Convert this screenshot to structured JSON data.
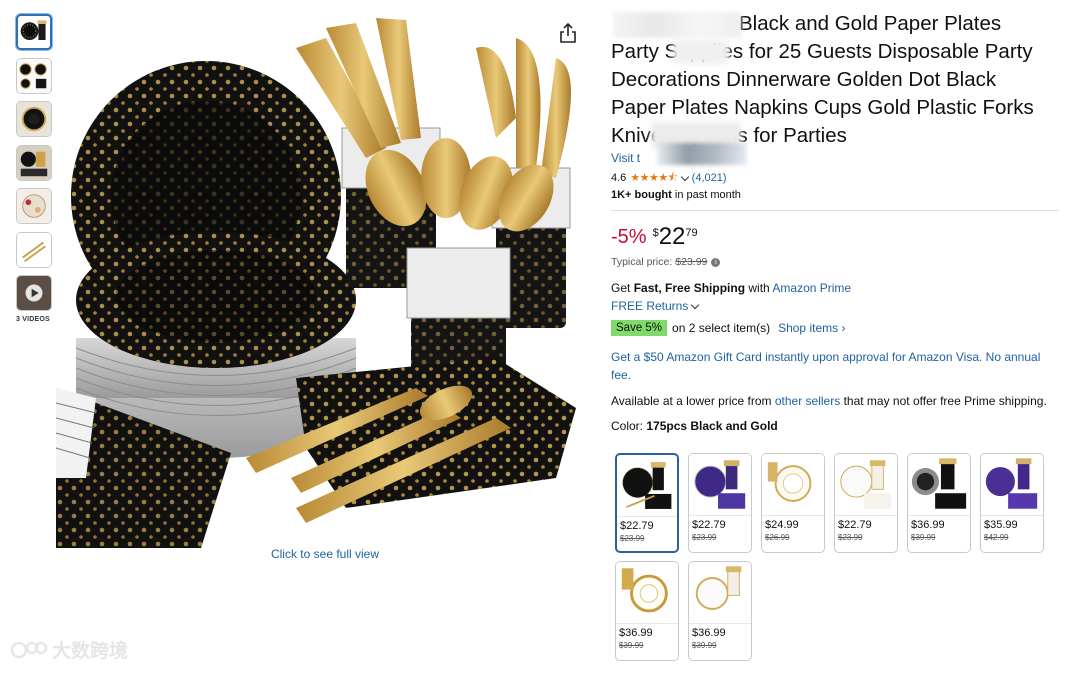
{
  "thumbnails": {
    "icons": [
      "product-thumb-1",
      "product-thumb-2",
      "product-thumb-3",
      "product-thumb-4",
      "product-thumb-5",
      "product-thumb-6",
      "video-thumb"
    ],
    "videos_label": "3 VIDEOS"
  },
  "main": {
    "full_view_label": "Click to see full view",
    "share_icon": "share-icon"
  },
  "product": {
    "title_line1": "Black and Gold Paper Plates",
    "title_line2": "Party Supplies for 25 Guests Disposable Party",
    "title_line3": "Decorations Dinnerware Golden Dot Black",
    "title_line4": "Paper Plates Napkins Cups Gold Plastic Forks",
    "title_line5": "Knives Spoons for Parties",
    "store_prefix": "Visit t",
    "rating": "4.6",
    "stars": "★★★★⯪",
    "rating_count": "(4,021)",
    "bought_bold": "1K+ bought",
    "bought_rest": " in past month"
  },
  "price": {
    "discount": "-5%",
    "currency": "$",
    "whole": "22",
    "fraction": "79",
    "typical_label": "Typical price:",
    "typical_value": "$23.99",
    "info_icon": "i"
  },
  "shipping": {
    "prefix": "Get ",
    "bold": "Fast, Free Shipping",
    "middle": " with ",
    "link": "Amazon Prime",
    "returns": "FREE Returns"
  },
  "promo": {
    "badge": "Save 5%",
    "text": "on 2 select item(s)",
    "link": "Shop items ›"
  },
  "gift_card": "Get a $50 Amazon Gift Card instantly upon approval for Amazon Visa. No annual fee.",
  "availability": {
    "prefix": "Available at a lower price from ",
    "link": "other sellers",
    "suffix": " that may not offer free Prime shipping."
  },
  "color": {
    "label": "Color: ",
    "selected": "175pcs Black and Gold"
  },
  "swatches": [
    {
      "price": "$22.79",
      "old": "$23.99",
      "theme": "black-gold"
    },
    {
      "price": "$22.79",
      "old": "$23.99",
      "theme": "purple"
    },
    {
      "price": "$24.99",
      "old": "$26.99",
      "theme": "white-gold"
    },
    {
      "price": "$22.79",
      "old": "$23.99",
      "theme": "white-gold"
    },
    {
      "price": "$36.99",
      "old": "$39.99",
      "theme": "black-gold"
    },
    {
      "price": "$35.99",
      "old": "$42.99",
      "theme": "purple"
    },
    {
      "price": "$36.99",
      "old": "$39.99",
      "theme": "white-gold"
    },
    {
      "price": "$36.99",
      "old": "$39.99",
      "theme": "white-gold"
    }
  ],
  "watermark": "大数跨境",
  "colors": {
    "link": "#2162a1",
    "discount": "#cc0c39",
    "save_badge": "#7fda69",
    "star": "#e47911",
    "gold": "#c9a24a"
  }
}
